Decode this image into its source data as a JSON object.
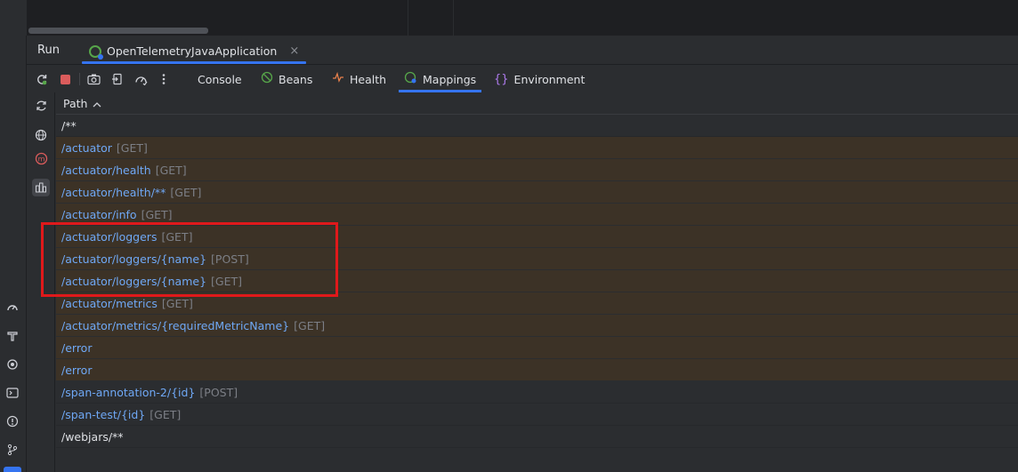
{
  "window": {
    "panel_title": "Run",
    "run_tab": "OpenTelemetryJavaApplication",
    "close_glyph": "×"
  },
  "toolbar": {
    "buttons": [
      "rerun-icon",
      "stop-icon",
      "screenshot-icon",
      "exit-icon",
      "dashboard-icon",
      "more-icon"
    ],
    "tabs": [
      {
        "label": "Console",
        "icon": ""
      },
      {
        "label": "Beans",
        "icon": "beans-icon"
      },
      {
        "label": "Health",
        "icon": "health-icon"
      },
      {
        "label": "Mappings",
        "icon": "mappings-icon",
        "active": true
      },
      {
        "label": "Environment",
        "icon": "environment-icon"
      }
    ]
  },
  "side_icons": [
    "refresh-icon",
    "globe-icon",
    "m-icon",
    "diagram-icon"
  ],
  "table": {
    "header": "Path",
    "sort": "ascending",
    "rows": [
      {
        "path": "/**",
        "method": "",
        "highlight": false,
        "plain": true
      },
      {
        "path": "/actuator",
        "method": "[GET]",
        "highlight": true
      },
      {
        "path": "/actuator/health",
        "method": "[GET]",
        "highlight": true
      },
      {
        "path": "/actuator/health/**",
        "method": "[GET]",
        "highlight": true
      },
      {
        "path": "/actuator/info",
        "method": "[GET]",
        "highlight": true
      },
      {
        "path": "/actuator/loggers",
        "method": "[GET]",
        "highlight": true
      },
      {
        "path": "/actuator/loggers/{name}",
        "method": "[POST]",
        "highlight": true
      },
      {
        "path": "/actuator/loggers/{name}",
        "method": "[GET]",
        "highlight": true
      },
      {
        "path": "/actuator/metrics",
        "method": "[GET]",
        "highlight": true
      },
      {
        "path": "/actuator/metrics/{requiredMetricName}",
        "method": "[GET]",
        "highlight": true
      },
      {
        "path": "/error",
        "method": "",
        "highlight": true
      },
      {
        "path": "/error",
        "method": "",
        "highlight": true
      },
      {
        "path": "/span-annotation-2/{id}",
        "method": "[POST]",
        "highlight": false
      },
      {
        "path": "/span-test/{id}",
        "method": "[GET]",
        "highlight": false
      },
      {
        "path": "/webjars/**",
        "method": "",
        "highlight": false,
        "plain": true
      }
    ]
  },
  "colors": {
    "accent": "#3574f0",
    "highlight_row": "#3c3226",
    "link": "#6fa8f5",
    "annotation_box": "#e0191b"
  }
}
